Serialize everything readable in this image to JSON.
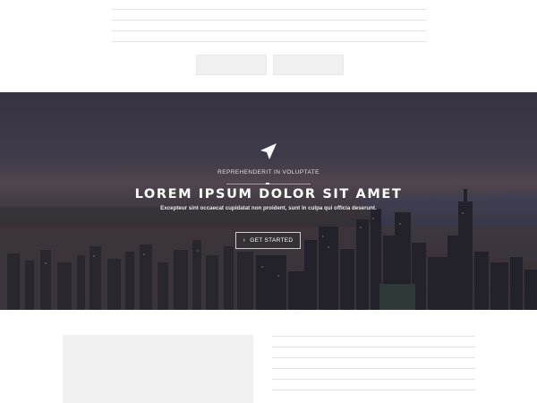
{
  "hero": {
    "eyebrow": "REPREHENDERIT IN VOLUPTATE",
    "title": "LOREM IPSUM DOLOR SIT AMET",
    "subtitle": "Excepteur sint occaecat cupidatat non proident, sunt in culpa qui officia deserunt.",
    "cta_label": "GET STARTED",
    "cta_icon": "chevron-right-icon",
    "logo_icon": "paper-plane-icon"
  },
  "colors": {
    "hero_overlay_top": "#3d3a4b",
    "hero_overlay_bottom": "#25252b",
    "placeholder": "#f0f0f0",
    "text": "#ffffff"
  }
}
